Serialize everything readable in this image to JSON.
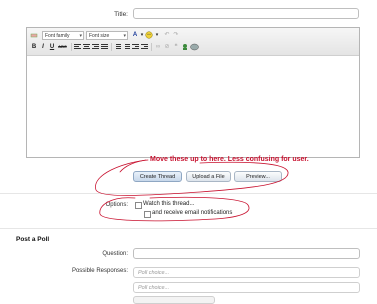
{
  "form": {
    "title_label": "Title:",
    "title_value": ""
  },
  "toolbar": {
    "font_family": "Font family",
    "font_size": "Font size",
    "bold": "B",
    "italic": "I",
    "underline": "U",
    "strike": "ABC",
    "color_letter": "A"
  },
  "annotation": {
    "text": "Move these up to here.  Less confusing for user.",
    "color": "#c8102e"
  },
  "buttons": {
    "create": "Create Thread",
    "upload": "Upload a File",
    "preview": "Preview..."
  },
  "options": {
    "label": "Options:",
    "watch": "Watch this thread...",
    "email": "and receive email notifications"
  },
  "poll": {
    "heading": "Post a Poll",
    "question_label": "Question:",
    "responses_label": "Possible Responses:",
    "choices": [
      "Poll choice...",
      "Poll choice..."
    ]
  }
}
